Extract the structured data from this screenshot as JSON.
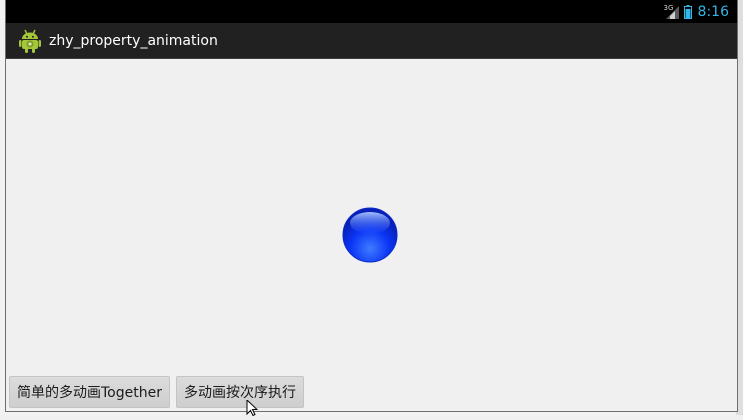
{
  "status_bar": {
    "network": "3G",
    "time": "8:16"
  },
  "action_bar": {
    "title": "zhy_property_animation",
    "icon": "android-robot-icon"
  },
  "content": {
    "ball": "blue-ball-icon",
    "buttons": [
      {
        "label": "简单的多动画Together"
      },
      {
        "label": "多动画按次序执行"
      }
    ]
  },
  "colors": {
    "status_bar_bg": "#000000",
    "action_bar_bg": "#212121",
    "content_bg": "#f0f0f0",
    "clock": "#33b5e5",
    "ball": "#0a35f5"
  }
}
